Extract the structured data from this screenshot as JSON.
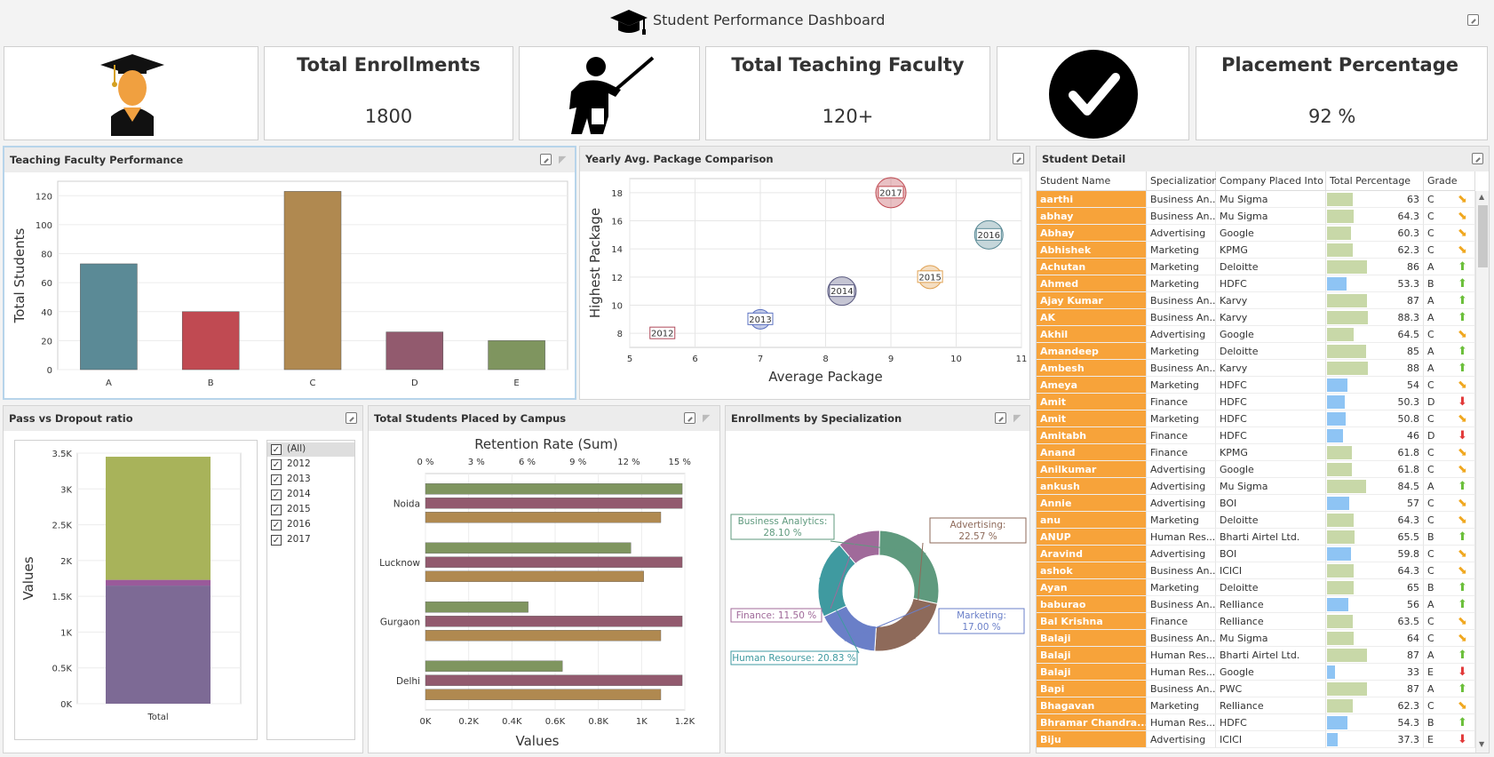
{
  "header": {
    "title": "Student Performance Dashboard"
  },
  "kpis": [
    {
      "title": "Total Enrollments",
      "value": "1800"
    },
    {
      "title": "Total Teaching Faculty",
      "value": "120+"
    },
    {
      "title": "Placement Percentage",
      "value": "92 %"
    }
  ],
  "panels": {
    "faculty": "Teaching Faculty Performance",
    "yearly": "Yearly Avg. Package Comparison",
    "student": "Student Detail",
    "pass": "Pass vs Dropout ratio",
    "campus": "Total Students Placed by Campus",
    "enroll": "Enrollments by Specialization"
  },
  "chart_data": [
    {
      "type": "bar",
      "ylabel": "Total Students",
      "categories": [
        "A",
        "B",
        "C",
        "D",
        "E"
      ],
      "values": [
        73,
        40,
        123,
        26,
        20
      ],
      "colors": [
        "#5b8a96",
        "#c04a52",
        "#b08950",
        "#925a6e",
        "#7f955f"
      ],
      "ylim": [
        0,
        130
      ],
      "yticks": [
        0,
        20,
        40,
        60,
        80,
        100,
        120
      ]
    },
    {
      "type": "scatter",
      "xlabel": "Average Package",
      "ylabel": "Highest Package",
      "xlim": [
        5,
        11
      ],
      "ylim": [
        7,
        19
      ],
      "xticks": [
        5,
        6,
        7,
        8,
        9,
        10,
        11
      ],
      "yticks": [
        8,
        10,
        12,
        14,
        16,
        18
      ],
      "points": [
        {
          "label": "2012",
          "x": 5.5,
          "y": 8,
          "r": 0,
          "color": "#b04a5a"
        },
        {
          "label": "2013",
          "x": 7,
          "y": 9,
          "r": 11,
          "color": "#5a70c0"
        },
        {
          "label": "2014",
          "x": 8.25,
          "y": 11,
          "r": 16,
          "color": "#5a5a80"
        },
        {
          "label": "2015",
          "x": 9.6,
          "y": 12,
          "r": 13,
          "color": "#e0a050"
        },
        {
          "label": "2016",
          "x": 10.5,
          "y": 15,
          "r": 16,
          "color": "#5a8a96"
        },
        {
          "label": "2017",
          "x": 9,
          "y": 18,
          "r": 17,
          "color": "#c04a52"
        }
      ]
    },
    {
      "type": "bar",
      "ylabel": "Values",
      "categories": [
        "Total"
      ],
      "series": [
        {
          "values": [
            1650
          ],
          "color": "#7d6a95"
        },
        {
          "values": [
            80
          ],
          "color": "#9a5a9a"
        },
        {
          "values": [
            1720
          ],
          "color": "#a8b35a"
        }
      ],
      "ylim": [
        0,
        3500
      ],
      "yticks": [
        "0K",
        "0.5K",
        "1K",
        "1.5K",
        "2K",
        "2.5K",
        "3K",
        "3.5K"
      ],
      "filter": [
        "(All)",
        "2012",
        "2013",
        "2014",
        "2015",
        "2016",
        "2017"
      ]
    },
    {
      "type": "bar",
      "title": "Retention Rate (Sum)",
      "xlabel": "Values",
      "categories": [
        "Noida",
        "Lucknow",
        "Gurgaon",
        "Delhi"
      ],
      "series": [
        {
          "values": [
            1.2,
            0.96,
            0.48,
            0.64
          ],
          "color": "#7f955f"
        },
        {
          "values": [
            1.2,
            1.2,
            1.2,
            1.2
          ],
          "color": "#925a6e"
        },
        {
          "values": [
            1.1,
            1.02,
            1.1,
            1.1
          ],
          "color": "#b08950"
        }
      ],
      "xlim": [
        0,
        1.2
      ],
      "xticks": [
        "0K",
        "0.2K",
        "0.4K",
        "0.6K",
        "0.8K",
        "1K",
        "1.2K"
      ],
      "top_ticks": [
        "0 %",
        "3 %",
        "6 %",
        "9 %",
        "12 %",
        "15 %"
      ]
    },
    {
      "type": "pie",
      "slices": [
        {
          "label": "Business Analytics:",
          "pct": "28.10 %",
          "value": 28.1,
          "color": "#5f9a7e"
        },
        {
          "label": "Advertising:",
          "pct": "22.57 %",
          "value": 22.57,
          "color": "#8e6a5a"
        },
        {
          "label": "Marketing:",
          "pct": "17.00 %",
          "value": 17.0,
          "color": "#6a7fc8"
        },
        {
          "label": "Human Resourse:",
          "pct": "20.83 %",
          "value": 20.83,
          "color": "#3f9aa0"
        },
        {
          "label": "Finance:",
          "pct": "11.50 %",
          "value": 11.5,
          "color": "#a06a9a"
        }
      ]
    }
  ],
  "table": {
    "columns": [
      "Student Name",
      "Specialization",
      "Company Placed Into",
      "Total Percentage",
      "Grade"
    ],
    "rows": [
      {
        "name": "aarthi",
        "spec": "Business An...",
        "company": "Mu Sigma",
        "pct": "63",
        "grade": "C",
        "trend": "side"
      },
      {
        "name": "abhay",
        "spec": "Business An...",
        "company": "Mu Sigma",
        "pct": "64.3",
        "grade": "C",
        "trend": "side"
      },
      {
        "name": "Abhay",
        "spec": "Advertising",
        "company": "Google",
        "pct": "60.3",
        "grade": "C",
        "trend": "side"
      },
      {
        "name": "Abhishek",
        "spec": "Marketing",
        "company": "KPMG",
        "pct": "62.3",
        "grade": "C",
        "trend": "side"
      },
      {
        "name": "Achutan",
        "spec": "Marketing",
        "company": "Deloitte",
        "pct": "86",
        "grade": "A",
        "trend": "up"
      },
      {
        "name": "Ahmed",
        "spec": "Marketing",
        "company": "HDFC",
        "pct": "53.3",
        "grade": "B",
        "trend": "up"
      },
      {
        "name": "Ajay Kumar",
        "spec": "Business An...",
        "company": "Karvy",
        "pct": "87",
        "grade": "A",
        "trend": "up"
      },
      {
        "name": "AK",
        "spec": "Business An...",
        "company": "Karvy",
        "pct": "88.3",
        "grade": "A",
        "trend": "up"
      },
      {
        "name": "Akhil",
        "spec": "Advertising",
        "company": "Google",
        "pct": "64.5",
        "grade": "C",
        "trend": "side"
      },
      {
        "name": "Amandeep",
        "spec": "Marketing",
        "company": "Deloitte",
        "pct": "85",
        "grade": "A",
        "trend": "up"
      },
      {
        "name": "Ambesh",
        "spec": "Business An...",
        "company": "Karvy",
        "pct": "88",
        "grade": "A",
        "trend": "up"
      },
      {
        "name": "Ameya",
        "spec": "Marketing",
        "company": "HDFC",
        "pct": "54",
        "grade": "C",
        "trend": "side"
      },
      {
        "name": "Amit",
        "spec": "Finance",
        "company": "HDFC",
        "pct": "50.3",
        "grade": "D",
        "trend": "down"
      },
      {
        "name": "Amit",
        "spec": "Marketing",
        "company": "HDFC",
        "pct": "50.8",
        "grade": "C",
        "trend": "side"
      },
      {
        "name": "Amitabh",
        "spec": "Finance",
        "company": "HDFC",
        "pct": "46",
        "grade": "D",
        "trend": "down"
      },
      {
        "name": "Anand",
        "spec": "Finance",
        "company": "KPMG",
        "pct": "61.8",
        "grade": "C",
        "trend": "side"
      },
      {
        "name": "Anilkumar",
        "spec": "Advertising",
        "company": "Google",
        "pct": "61.8",
        "grade": "C",
        "trend": "side"
      },
      {
        "name": "ankush",
        "spec": "Advertising",
        "company": "Mu Sigma",
        "pct": "84.5",
        "grade": "A",
        "trend": "up"
      },
      {
        "name": "Annie",
        "spec": "Advertising",
        "company": "BOI",
        "pct": "57",
        "grade": "C",
        "trend": "side"
      },
      {
        "name": "anu",
        "spec": "Marketing",
        "company": "Deloitte",
        "pct": "64.3",
        "grade": "C",
        "trend": "side"
      },
      {
        "name": "ANUP",
        "spec": "Human Res...",
        "company": "Bharti Airtel Ltd.",
        "pct": "65.5",
        "grade": "B",
        "trend": "up"
      },
      {
        "name": "Aravind",
        "spec": "Advertising",
        "company": "BOI",
        "pct": "59.8",
        "grade": "C",
        "trend": "side"
      },
      {
        "name": "ashok",
        "spec": "Business An...",
        "company": "ICICI",
        "pct": "64.3",
        "grade": "C",
        "trend": "side"
      },
      {
        "name": "Ayan",
        "spec": "Marketing",
        "company": "Deloitte",
        "pct": "65",
        "grade": "B",
        "trend": "up"
      },
      {
        "name": "baburao",
        "spec": "Business An...",
        "company": "Relliance",
        "pct": "56",
        "grade": "A",
        "trend": "up"
      },
      {
        "name": "Bal Krishna",
        "spec": "Finance",
        "company": "Relliance",
        "pct": "63.5",
        "grade": "C",
        "trend": "side"
      },
      {
        "name": "Balaji",
        "spec": "Business An...",
        "company": "Mu Sigma",
        "pct": "64",
        "grade": "C",
        "trend": "side"
      },
      {
        "name": "Balaji",
        "spec": "Human Res...",
        "company": "Bharti Airtel Ltd.",
        "pct": "87",
        "grade": "A",
        "trend": "up"
      },
      {
        "name": "Balaji",
        "spec": "Human Res...",
        "company": "Google",
        "pct": "33",
        "grade": "E",
        "trend": "down"
      },
      {
        "name": "Bapi",
        "spec": "Business An...",
        "company": "PWC",
        "pct": "87",
        "grade": "A",
        "trend": "up"
      },
      {
        "name": "Bhagavan",
        "spec": "Marketing",
        "company": "Relliance",
        "pct": "62.3",
        "grade": "C",
        "trend": "side"
      },
      {
        "name": "Bhramar Chandra...",
        "spec": "Human Res...",
        "company": "HDFC",
        "pct": "54.3",
        "grade": "B",
        "trend": "up"
      },
      {
        "name": "Biju",
        "spec": "Advertising",
        "company": "ICICI",
        "pct": "37.3",
        "grade": "E",
        "trend": "down"
      }
    ]
  }
}
